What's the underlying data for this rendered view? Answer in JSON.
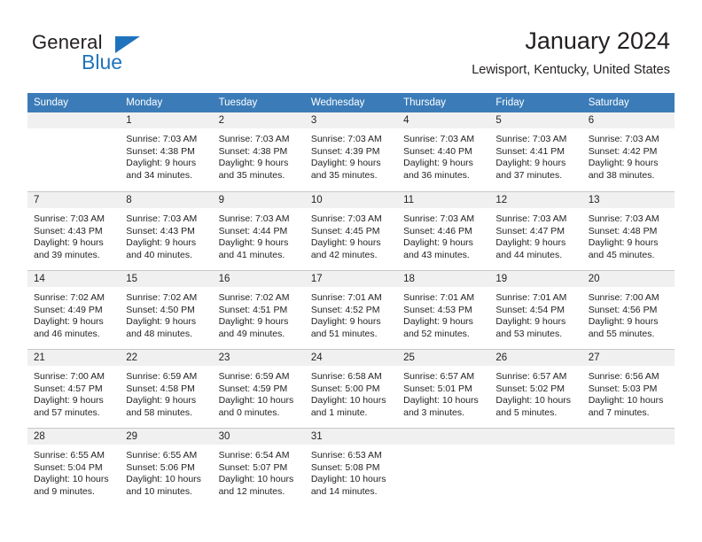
{
  "brand": {
    "word_one": "General",
    "word_two": "Blue",
    "accent_color": "#1f73bd"
  },
  "header": {
    "title": "January 2024",
    "subtitle": "Lewisport, Kentucky, United States",
    "header_bg_color": "#3b7cb8",
    "daynum_bg_color": "#f0f0f0"
  },
  "calendar": {
    "weekday_headers": [
      "Sunday",
      "Monday",
      "Tuesday",
      "Wednesday",
      "Thursday",
      "Friday",
      "Saturday"
    ],
    "weeks": [
      [
        {
          "day": "",
          "sunrise": "",
          "sunset": "",
          "daylight_line1": "",
          "daylight_line2": ""
        },
        {
          "day": "1",
          "sunrise": "Sunrise: 7:03 AM",
          "sunset": "Sunset: 4:38 PM",
          "daylight_line1": "Daylight: 9 hours",
          "daylight_line2": "and 34 minutes."
        },
        {
          "day": "2",
          "sunrise": "Sunrise: 7:03 AM",
          "sunset": "Sunset: 4:38 PM",
          "daylight_line1": "Daylight: 9 hours",
          "daylight_line2": "and 35 minutes."
        },
        {
          "day": "3",
          "sunrise": "Sunrise: 7:03 AM",
          "sunset": "Sunset: 4:39 PM",
          "daylight_line1": "Daylight: 9 hours",
          "daylight_line2": "and 35 minutes."
        },
        {
          "day": "4",
          "sunrise": "Sunrise: 7:03 AM",
          "sunset": "Sunset: 4:40 PM",
          "daylight_line1": "Daylight: 9 hours",
          "daylight_line2": "and 36 minutes."
        },
        {
          "day": "5",
          "sunrise": "Sunrise: 7:03 AM",
          "sunset": "Sunset: 4:41 PM",
          "daylight_line1": "Daylight: 9 hours",
          "daylight_line2": "and 37 minutes."
        },
        {
          "day": "6",
          "sunrise": "Sunrise: 7:03 AM",
          "sunset": "Sunset: 4:42 PM",
          "daylight_line1": "Daylight: 9 hours",
          "daylight_line2": "and 38 minutes."
        }
      ],
      [
        {
          "day": "7",
          "sunrise": "Sunrise: 7:03 AM",
          "sunset": "Sunset: 4:43 PM",
          "daylight_line1": "Daylight: 9 hours",
          "daylight_line2": "and 39 minutes."
        },
        {
          "day": "8",
          "sunrise": "Sunrise: 7:03 AM",
          "sunset": "Sunset: 4:43 PM",
          "daylight_line1": "Daylight: 9 hours",
          "daylight_line2": "and 40 minutes."
        },
        {
          "day": "9",
          "sunrise": "Sunrise: 7:03 AM",
          "sunset": "Sunset: 4:44 PM",
          "daylight_line1": "Daylight: 9 hours",
          "daylight_line2": "and 41 minutes."
        },
        {
          "day": "10",
          "sunrise": "Sunrise: 7:03 AM",
          "sunset": "Sunset: 4:45 PM",
          "daylight_line1": "Daylight: 9 hours",
          "daylight_line2": "and 42 minutes."
        },
        {
          "day": "11",
          "sunrise": "Sunrise: 7:03 AM",
          "sunset": "Sunset: 4:46 PM",
          "daylight_line1": "Daylight: 9 hours",
          "daylight_line2": "and 43 minutes."
        },
        {
          "day": "12",
          "sunrise": "Sunrise: 7:03 AM",
          "sunset": "Sunset: 4:47 PM",
          "daylight_line1": "Daylight: 9 hours",
          "daylight_line2": "and 44 minutes."
        },
        {
          "day": "13",
          "sunrise": "Sunrise: 7:03 AM",
          "sunset": "Sunset: 4:48 PM",
          "daylight_line1": "Daylight: 9 hours",
          "daylight_line2": "and 45 minutes."
        }
      ],
      [
        {
          "day": "14",
          "sunrise": "Sunrise: 7:02 AM",
          "sunset": "Sunset: 4:49 PM",
          "daylight_line1": "Daylight: 9 hours",
          "daylight_line2": "and 46 minutes."
        },
        {
          "day": "15",
          "sunrise": "Sunrise: 7:02 AM",
          "sunset": "Sunset: 4:50 PM",
          "daylight_line1": "Daylight: 9 hours",
          "daylight_line2": "and 48 minutes."
        },
        {
          "day": "16",
          "sunrise": "Sunrise: 7:02 AM",
          "sunset": "Sunset: 4:51 PM",
          "daylight_line1": "Daylight: 9 hours",
          "daylight_line2": "and 49 minutes."
        },
        {
          "day": "17",
          "sunrise": "Sunrise: 7:01 AM",
          "sunset": "Sunset: 4:52 PM",
          "daylight_line1": "Daylight: 9 hours",
          "daylight_line2": "and 51 minutes."
        },
        {
          "day": "18",
          "sunrise": "Sunrise: 7:01 AM",
          "sunset": "Sunset: 4:53 PM",
          "daylight_line1": "Daylight: 9 hours",
          "daylight_line2": "and 52 minutes."
        },
        {
          "day": "19",
          "sunrise": "Sunrise: 7:01 AM",
          "sunset": "Sunset: 4:54 PM",
          "daylight_line1": "Daylight: 9 hours",
          "daylight_line2": "and 53 minutes."
        },
        {
          "day": "20",
          "sunrise": "Sunrise: 7:00 AM",
          "sunset": "Sunset: 4:56 PM",
          "daylight_line1": "Daylight: 9 hours",
          "daylight_line2": "and 55 minutes."
        }
      ],
      [
        {
          "day": "21",
          "sunrise": "Sunrise: 7:00 AM",
          "sunset": "Sunset: 4:57 PM",
          "daylight_line1": "Daylight: 9 hours",
          "daylight_line2": "and 57 minutes."
        },
        {
          "day": "22",
          "sunrise": "Sunrise: 6:59 AM",
          "sunset": "Sunset: 4:58 PM",
          "daylight_line1": "Daylight: 9 hours",
          "daylight_line2": "and 58 minutes."
        },
        {
          "day": "23",
          "sunrise": "Sunrise: 6:59 AM",
          "sunset": "Sunset: 4:59 PM",
          "daylight_line1": "Daylight: 10 hours",
          "daylight_line2": "and 0 minutes."
        },
        {
          "day": "24",
          "sunrise": "Sunrise: 6:58 AM",
          "sunset": "Sunset: 5:00 PM",
          "daylight_line1": "Daylight: 10 hours",
          "daylight_line2": "and 1 minute."
        },
        {
          "day": "25",
          "sunrise": "Sunrise: 6:57 AM",
          "sunset": "Sunset: 5:01 PM",
          "daylight_line1": "Daylight: 10 hours",
          "daylight_line2": "and 3 minutes."
        },
        {
          "day": "26",
          "sunrise": "Sunrise: 6:57 AM",
          "sunset": "Sunset: 5:02 PM",
          "daylight_line1": "Daylight: 10 hours",
          "daylight_line2": "and 5 minutes."
        },
        {
          "day": "27",
          "sunrise": "Sunrise: 6:56 AM",
          "sunset": "Sunset: 5:03 PM",
          "daylight_line1": "Daylight: 10 hours",
          "daylight_line2": "and 7 minutes."
        }
      ],
      [
        {
          "day": "28",
          "sunrise": "Sunrise: 6:55 AM",
          "sunset": "Sunset: 5:04 PM",
          "daylight_line1": "Daylight: 10 hours",
          "daylight_line2": "and 9 minutes."
        },
        {
          "day": "29",
          "sunrise": "Sunrise: 6:55 AM",
          "sunset": "Sunset: 5:06 PM",
          "daylight_line1": "Daylight: 10 hours",
          "daylight_line2": "and 10 minutes."
        },
        {
          "day": "30",
          "sunrise": "Sunrise: 6:54 AM",
          "sunset": "Sunset: 5:07 PM",
          "daylight_line1": "Daylight: 10 hours",
          "daylight_line2": "and 12 minutes."
        },
        {
          "day": "31",
          "sunrise": "Sunrise: 6:53 AM",
          "sunset": "Sunset: 5:08 PM",
          "daylight_line1": "Daylight: 10 hours",
          "daylight_line2": "and 14 minutes."
        },
        {
          "day": "",
          "sunrise": "",
          "sunset": "",
          "daylight_line1": "",
          "daylight_line2": ""
        },
        {
          "day": "",
          "sunrise": "",
          "sunset": "",
          "daylight_line1": "",
          "daylight_line2": ""
        },
        {
          "day": "",
          "sunrise": "",
          "sunset": "",
          "daylight_line1": "",
          "daylight_line2": ""
        }
      ]
    ]
  }
}
